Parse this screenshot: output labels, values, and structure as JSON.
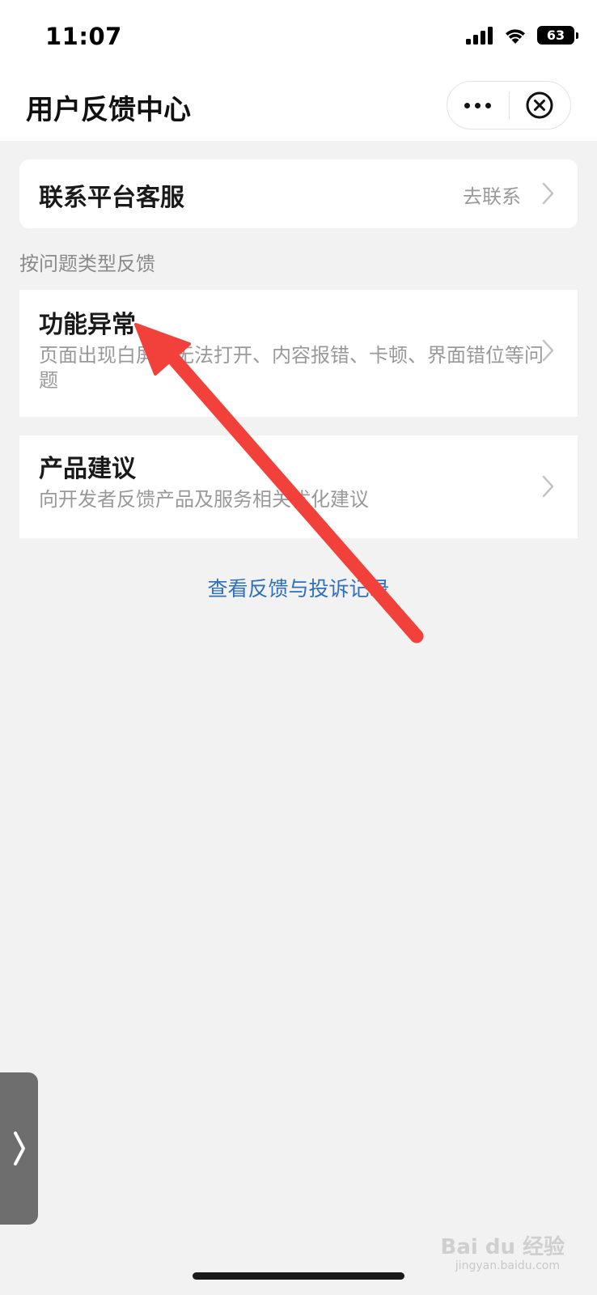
{
  "status_bar": {
    "time": "11:07",
    "battery": "63"
  },
  "nav": {
    "title": "用户反馈中心"
  },
  "contact": {
    "label": "联系平台客服",
    "action": "去联系"
  },
  "section_label": "按问题类型反馈",
  "feedback_types": [
    {
      "title": "功能异常",
      "desc": "页面出现白屏、无法打开、内容报错、卡顿、界面错位等问题"
    },
    {
      "title": "产品建议",
      "desc": "向开发者反馈产品及服务相关优化建议"
    }
  ],
  "history_link": "查看反馈与投诉记录",
  "watermark": {
    "brand": "Bai du 经验",
    "url": "jingyan.baidu.com"
  },
  "colors": {
    "link": "#2f6fbd",
    "annotation_arrow": "#f2413a",
    "background": "#f2f2f2"
  }
}
